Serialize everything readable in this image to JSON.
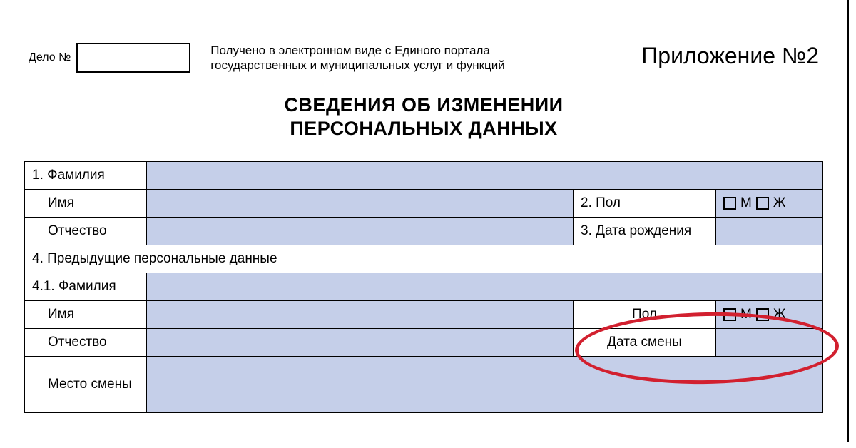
{
  "header": {
    "delo_label": "Дело №",
    "received_text": "Получено в электронном виде с Единого портала государственных и муниципальных услуг и функций",
    "appendix": "Приложение №2"
  },
  "title": {
    "line1": "СВЕДЕНИЯ ОБ ИЗМЕНЕНИИ",
    "line2": "ПЕРСОНАЛЬНЫХ ДАННЫХ"
  },
  "form": {
    "r1_label": "1. Фамилия",
    "r2_label": "Имя",
    "r2_sec_label": "2. Пол",
    "r2_m": "М",
    "r2_zh": "Ж",
    "r3_label": "Отчество",
    "r3_sec_label": "3. Дата рождения",
    "r4_label": "4. Предыдущие персональные данные",
    "r41_label": "4.1. Фамилия",
    "r5_label": "Имя",
    "r5_sec_label": "Пол",
    "r5_m": "М",
    "r5_zh": "Ж",
    "r6_label": "Отчество",
    "r6_sec_label": "Дата смены",
    "r7_label": "Место смены"
  }
}
